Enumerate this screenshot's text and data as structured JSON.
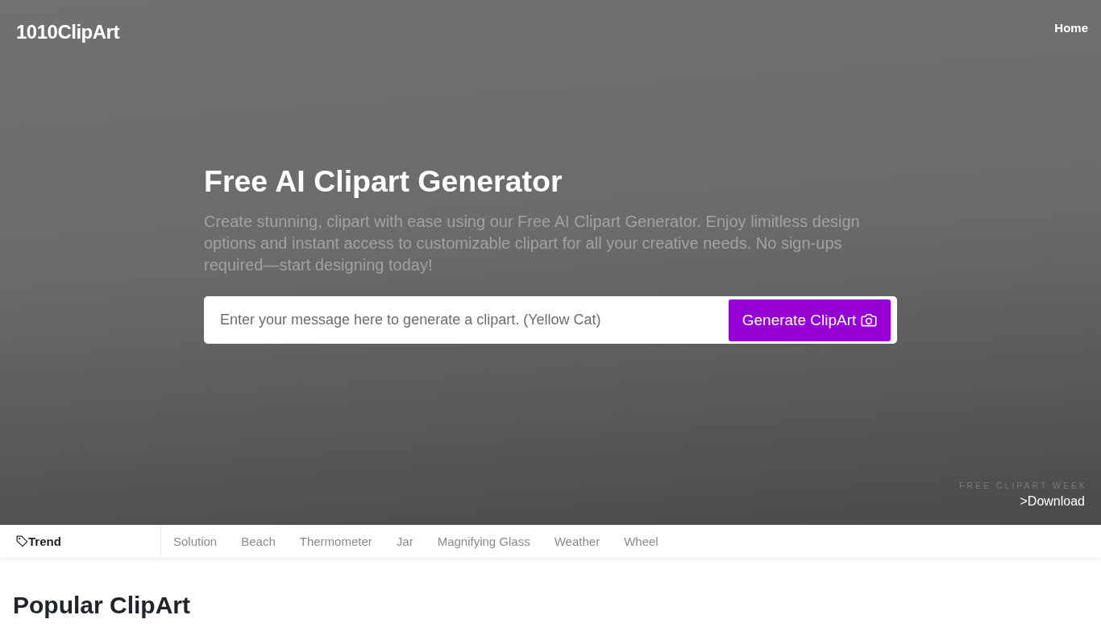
{
  "header": {
    "logo": "1010ClipArt",
    "nav": [
      {
        "label": "Home"
      }
    ]
  },
  "hero": {
    "title": "Free AI Clipart Generator",
    "description": "Create stunning, clipart with ease using our Free AI Clipart Generator. Enjoy limitless design options and instant access to customizable clipart for all your creative needs. No sign-ups required—start designing today!",
    "search": {
      "placeholder": "Enter your message here to generate a clipart. (Yellow Cat)",
      "button": "Generate ClipArt"
    },
    "promo": {
      "caption": "FREE CLIPART WEEK",
      "link": ">Download"
    }
  },
  "tags": {
    "label": "Trend",
    "items": [
      "Solution",
      "Beach",
      "Thermometer",
      "Jar",
      "Magnifying Glass",
      "Weather",
      "Wheel"
    ]
  },
  "section": {
    "title": "Popular ClipArt"
  }
}
